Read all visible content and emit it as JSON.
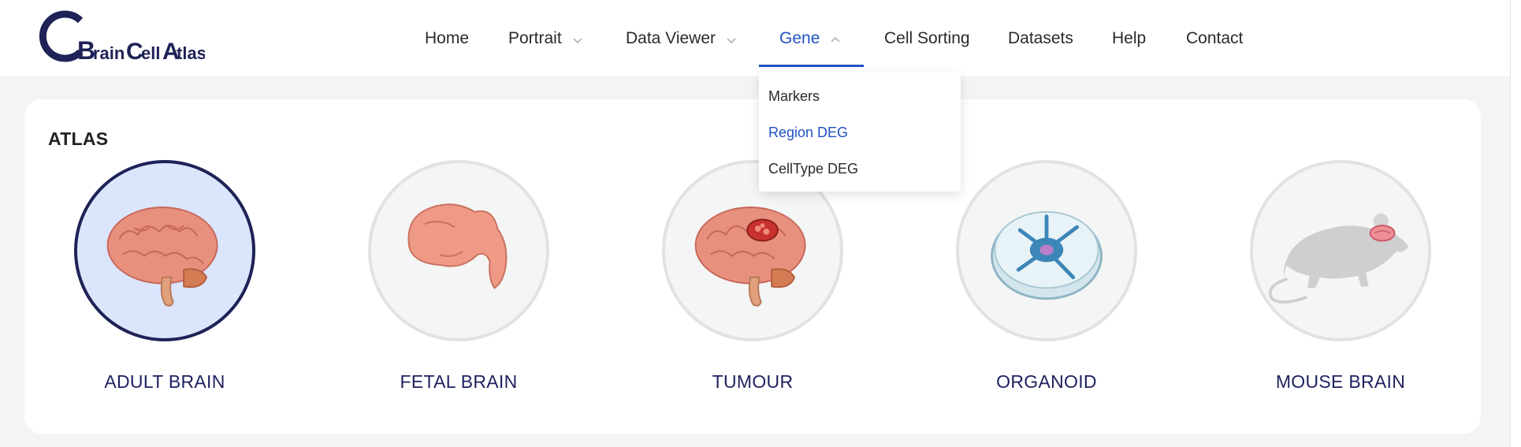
{
  "brand": {
    "logo_text": "BrainCellAtlas",
    "color": "#1f2257"
  },
  "nav": {
    "items": [
      {
        "label": "Home",
        "has_dropdown": false
      },
      {
        "label": "Portrait",
        "has_dropdown": true
      },
      {
        "label": "Data Viewer",
        "has_dropdown": true
      },
      {
        "label": "Gene",
        "has_dropdown": true,
        "active": true
      },
      {
        "label": "Cell Sorting",
        "has_dropdown": false
      },
      {
        "label": "Datasets",
        "has_dropdown": false
      },
      {
        "label": "Help",
        "has_dropdown": false
      },
      {
        "label": "Contact",
        "has_dropdown": false
      }
    ],
    "accent_color": "#2152c4"
  },
  "gene_menu": {
    "items": [
      {
        "label": "Markers",
        "active": false
      },
      {
        "label": "Region DEG",
        "active": true
      },
      {
        "label": "CellType DEG",
        "active": false
      }
    ]
  },
  "atlas": {
    "title": "ATLAS",
    "items": [
      {
        "label": "ADULT BRAIN",
        "icon": "adult-brain-icon",
        "selected": true
      },
      {
        "label": "FETAL BRAIN",
        "icon": "fetal-brain-icon",
        "selected": false
      },
      {
        "label": "TUMOUR",
        "icon": "tumour-brain-icon",
        "selected": false
      },
      {
        "label": "ORGANOID",
        "icon": "organoid-dish-icon",
        "selected": false
      },
      {
        "label": "MOUSE BRAIN",
        "icon": "mouse-brain-icon",
        "selected": false
      }
    ]
  }
}
